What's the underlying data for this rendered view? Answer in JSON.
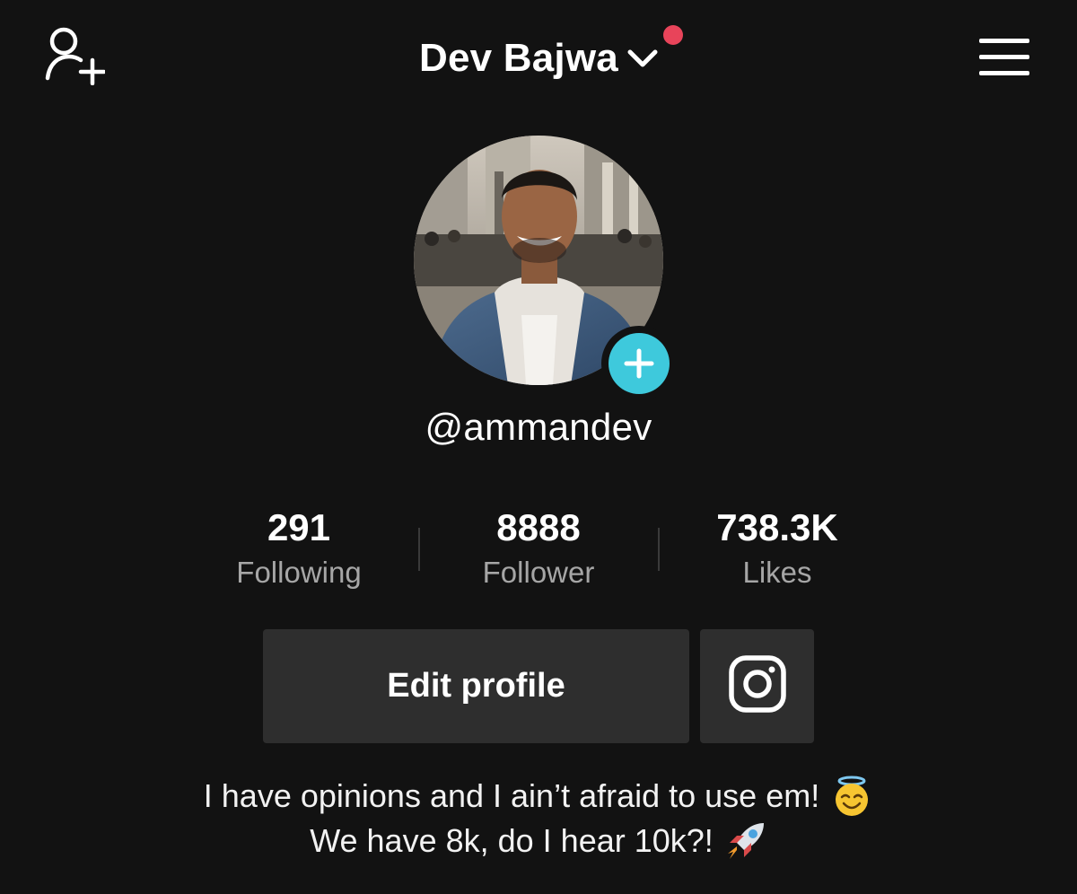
{
  "header": {
    "add_user_icon": "add-user-icon",
    "title": "Dev Bajwa",
    "dropdown_icon": "chevron-down-icon",
    "notification_dot_color": "#e8445a",
    "menu_icon": "hamburger-menu-icon"
  },
  "profile": {
    "avatar_icon": "profile-photo",
    "add_button_color": "#3ec9dc",
    "username": "@ammandev"
  },
  "stats": [
    {
      "value": "291",
      "label": "Following"
    },
    {
      "value": "8888",
      "label": "Follower"
    },
    {
      "value": "738.3K",
      "label": "Likes"
    }
  ],
  "actions": {
    "edit_profile_label": "Edit profile",
    "instagram_icon": "instagram-icon"
  },
  "bio": {
    "line1": "I have opinions and I ain’t afraid to use em!",
    "line1_emoji": "smiling-face-with-halo",
    "line2": "We have 8k, do I hear 10k?!",
    "line2_emoji": "rocket"
  },
  "colors": {
    "background": "#121212",
    "button_bg": "#2e2e2e",
    "secondary_text": "#a6a6a6"
  }
}
